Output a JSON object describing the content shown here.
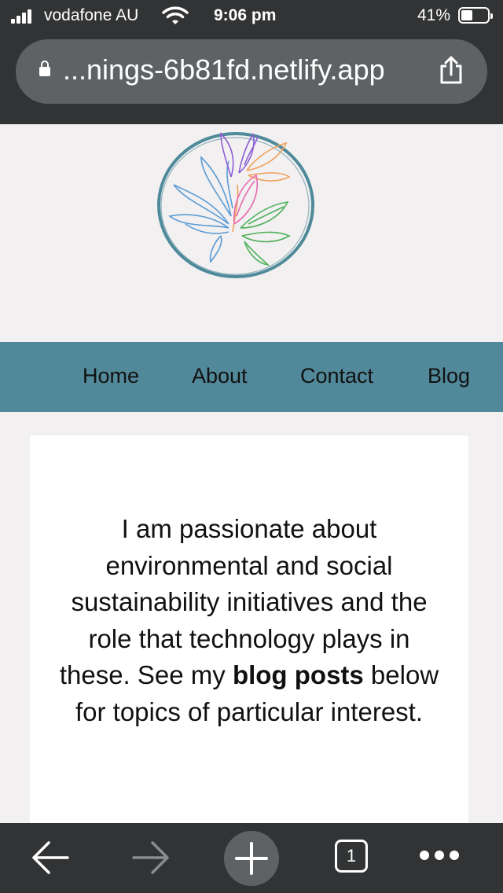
{
  "status_bar": {
    "carrier": "vodafone AU",
    "time": "9:06 pm",
    "battery_percent": "41%",
    "battery_level": 0.41
  },
  "browser": {
    "url": "...nings-6b81fd.netlify.app",
    "open_tabs": "1"
  },
  "nav": {
    "items": [
      {
        "label": "Home"
      },
      {
        "label": "About"
      },
      {
        "label": "Contact"
      },
      {
        "label": "Blog"
      }
    ]
  },
  "intro": {
    "text_before": "I am passionate about environmental and social sustainability initiatives and the role that technology plays in these. See my ",
    "bold": "blog posts",
    "text_after": " below for topics of particular interest."
  },
  "colors": {
    "nav_background": "#52899a",
    "page_background": "#f2f0f1",
    "browser_chrome": "#323334"
  },
  "icons": {
    "lock": "lock-icon",
    "share": "share-icon",
    "back": "back-arrow-icon",
    "forward": "forward-arrow-icon",
    "new_tab": "plus-icon",
    "more": "more-dots-icon"
  }
}
